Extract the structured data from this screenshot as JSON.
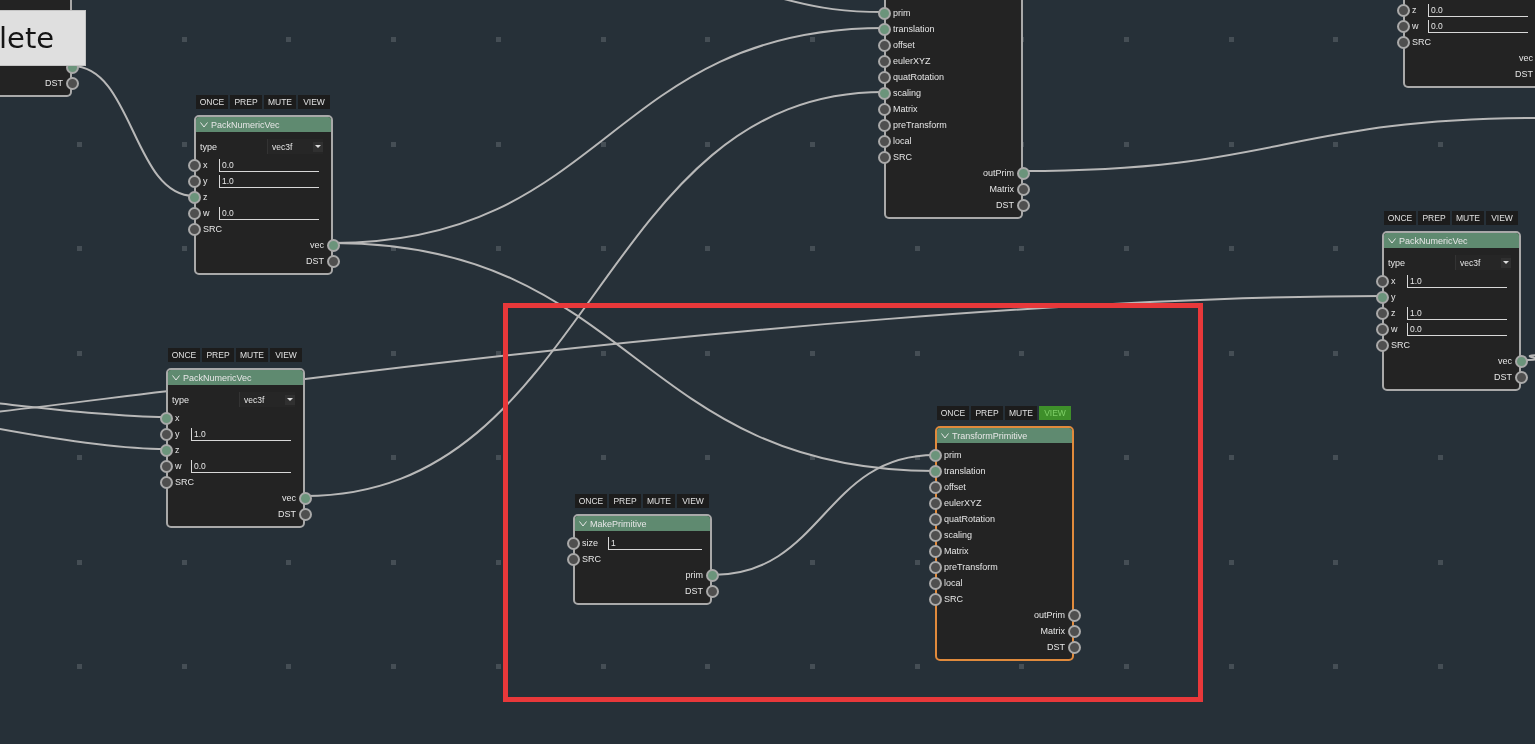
{
  "popup": {
    "text": "lete"
  },
  "nodes": [
    {
      "outputs": [
        {
          "connected": true
        },
        {
          "label": "DST",
          "connected": false
        }
      ]
    },
    {
      "selected": false,
      "inputs": [
        {
          "label": "prim",
          "connected": true
        },
        {
          "label": "translation",
          "connected": true
        },
        {
          "label": "offset",
          "connected": false
        },
        {
          "label": "eulerXYZ",
          "connected": false
        },
        {
          "label": "quatRotation",
          "connected": false
        },
        {
          "label": "scaling",
          "connected": true
        },
        {
          "label": "Matrix",
          "connected": false
        },
        {
          "label": "preTransform",
          "connected": false
        },
        {
          "label": "local",
          "connected": false
        },
        {
          "label": "SRC",
          "connected": false
        }
      ],
      "outputs": [
        {
          "label": "outPrim",
          "connected": true
        },
        {
          "label": "Matrix",
          "connected": false
        },
        {
          "label": "DST",
          "connected": false
        }
      ]
    },
    {
      "inputs": [
        {
          "label": "z",
          "connected": false,
          "value": "0.0"
        },
        {
          "label": "w",
          "connected": false,
          "value": "0.0"
        },
        {
          "label": "SRC",
          "connected": false
        }
      ],
      "outputs": [
        {
          "label": "vec"
        },
        {
          "label": "DST"
        }
      ]
    },
    {
      "title": "PackNumericVec",
      "selected": false,
      "buttons": [
        {
          "label": "ONCE",
          "on": false
        },
        {
          "label": "PREP",
          "on": false
        },
        {
          "label": "MUTE",
          "on": false
        },
        {
          "label": "VIEW",
          "on": false
        }
      ],
      "type_field": {
        "label": "type",
        "value": "vec3f"
      },
      "inputs": [
        {
          "label": "x",
          "connected": false,
          "value": "0.0"
        },
        {
          "label": "y",
          "connected": false,
          "value": "1.0"
        },
        {
          "label": "z",
          "connected": true
        },
        {
          "label": "w",
          "connected": false,
          "value": "0.0"
        },
        {
          "label": "SRC",
          "connected": false
        }
      ],
      "outputs": [
        {
          "label": "vec",
          "connected": true
        },
        {
          "label": "DST",
          "connected": false
        }
      ]
    },
    {
      "title": "PackNumericVec",
      "selected": false,
      "buttons": [
        {
          "label": "ONCE",
          "on": false
        },
        {
          "label": "PREP",
          "on": false
        },
        {
          "label": "MUTE",
          "on": false
        },
        {
          "label": "VIEW",
          "on": false
        }
      ],
      "type_field": {
        "label": "type",
        "value": "vec3f"
      },
      "inputs": [
        {
          "label": "x",
          "connected": false,
          "value": "1.0"
        },
        {
          "label": "y",
          "connected": true
        },
        {
          "label": "z",
          "connected": false,
          "value": "1.0"
        },
        {
          "label": "w",
          "connected": false,
          "value": "0.0"
        },
        {
          "label": "SRC",
          "connected": false
        }
      ],
      "outputs": [
        {
          "label": "vec",
          "connected": true
        },
        {
          "label": "DST",
          "connected": false
        }
      ]
    },
    {
      "title": "PackNumericVec",
      "selected": false,
      "buttons": [
        {
          "label": "ONCE",
          "on": false
        },
        {
          "label": "PREP",
          "on": false
        },
        {
          "label": "MUTE",
          "on": false
        },
        {
          "label": "VIEW",
          "on": false
        }
      ],
      "type_field": {
        "label": "type",
        "value": "vec3f"
      },
      "inputs": [
        {
          "label": "x",
          "connected": true
        },
        {
          "label": "y",
          "connected": false,
          "value": "1.0"
        },
        {
          "label": "z",
          "connected": true
        },
        {
          "label": "w",
          "connected": false,
          "value": "0.0"
        },
        {
          "label": "SRC",
          "connected": false
        }
      ],
      "outputs": [
        {
          "label": "vec",
          "connected": true
        },
        {
          "label": "DST",
          "connected": false
        }
      ]
    },
    {
      "title": "MakePrimitive",
      "selected": false,
      "buttons": [
        {
          "label": "ONCE",
          "on": false
        },
        {
          "label": "PREP",
          "on": false
        },
        {
          "label": "MUTE",
          "on": false
        },
        {
          "label": "VIEW",
          "on": false
        }
      ],
      "inputs": [
        {
          "label": "size",
          "connected": false,
          "value": "1"
        },
        {
          "label": "SRC",
          "connected": false
        }
      ],
      "outputs": [
        {
          "label": "prim",
          "connected": true
        },
        {
          "label": "DST",
          "connected": false
        }
      ]
    },
    {
      "title": "TransformPrimitive",
      "selected": true,
      "buttons": [
        {
          "label": "ONCE",
          "on": false
        },
        {
          "label": "PREP",
          "on": false
        },
        {
          "label": "MUTE",
          "on": false
        },
        {
          "label": "VIEW",
          "on": true
        }
      ],
      "inputs": [
        {
          "label": "prim",
          "connected": true
        },
        {
          "label": "translation",
          "connected": true
        },
        {
          "label": "offset",
          "connected": false
        },
        {
          "label": "eulerXYZ",
          "connected": false
        },
        {
          "label": "quatRotation",
          "connected": false
        },
        {
          "label": "scaling",
          "connected": false
        },
        {
          "label": "Matrix",
          "connected": false
        },
        {
          "label": "preTransform",
          "connected": false
        },
        {
          "label": "local",
          "connected": false
        },
        {
          "label": "SRC",
          "connected": false
        }
      ],
      "outputs": [
        {
          "label": "outPrim",
          "connected": false
        },
        {
          "label": "Matrix",
          "connected": false
        },
        {
          "label": "DST",
          "connected": false
        }
      ]
    }
  ],
  "annotations": [
    {
      "kind": "frame"
    }
  ]
}
